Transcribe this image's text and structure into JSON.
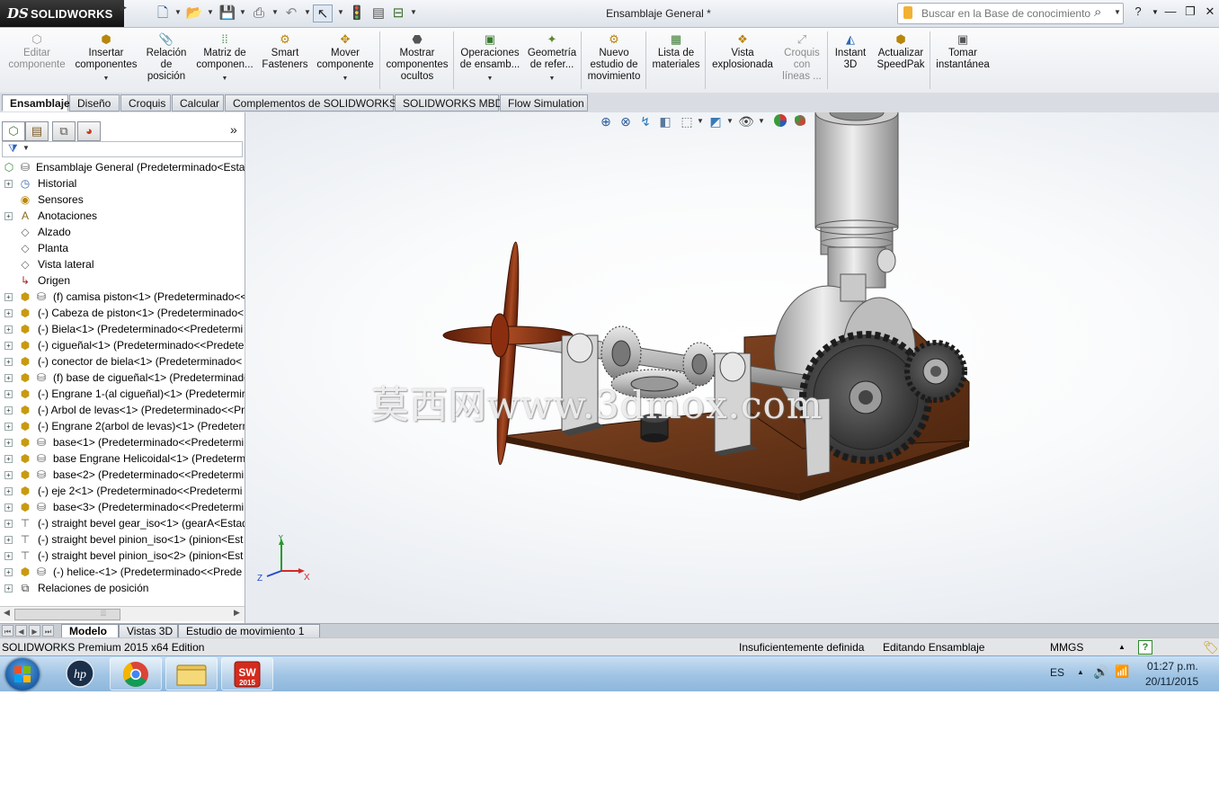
{
  "app": {
    "brand_icon": "DS",
    "brand": "SOLIDWORKS",
    "title": "Ensamblaje  General *",
    "search_placeholder": "Buscar en la Base de conocimiento"
  },
  "quick_access": [
    "new-icon",
    "open-icon",
    "save-icon",
    "print-icon",
    "undo-icon",
    "select-icon",
    "rebuild-icon",
    "file-properties-icon",
    "options-icon"
  ],
  "window_buttons": {
    "help": "?",
    "minimize": "—",
    "restore": "❐",
    "close": "✕"
  },
  "commands": [
    {
      "line1": "Editar",
      "line2": "componente",
      "line3": "",
      "enabled": false
    },
    {
      "line1": "Insertar",
      "line2": "componentes",
      "line3": "",
      "enabled": true
    },
    {
      "line1": "Relación",
      "line2": "de",
      "line3": "posición",
      "enabled": true
    },
    {
      "line1": "Matriz de",
      "line2": "componen...",
      "line3": "",
      "enabled": true
    },
    {
      "line1": "Smart",
      "line2": "Fasteners",
      "line3": "",
      "enabled": true
    },
    {
      "line1": "Mover",
      "line2": "componente",
      "line3": "",
      "enabled": true
    },
    {
      "line1": "Mostrar",
      "line2": "componentes",
      "line3": "ocultos",
      "enabled": true
    },
    {
      "line1": "Operaciones",
      "line2": "de ensamb...",
      "line3": "",
      "enabled": true
    },
    {
      "line1": "Geometría",
      "line2": "de refer...",
      "line3": "",
      "enabled": true
    },
    {
      "line1": "Nuevo",
      "line2": "estudio de",
      "line3": "movimiento",
      "enabled": true
    },
    {
      "line1": "Lista de",
      "line2": "materiales",
      "line3": "",
      "enabled": true
    },
    {
      "line1": "Vista",
      "line2": "explosionada",
      "line3": "",
      "enabled": true
    },
    {
      "line1": "Croquis",
      "line2": "con",
      "line3": "líneas ...",
      "enabled": false
    },
    {
      "line1": "Instant",
      "line2": "3D",
      "line3": "",
      "enabled": true
    },
    {
      "line1": "Actualizar",
      "line2": "SpeedPak",
      "line3": "",
      "enabled": true
    },
    {
      "line1": "Tomar",
      "line2": "instantánea",
      "line3": "",
      "enabled": true
    }
  ],
  "tabs": [
    "Ensamblaje",
    "Diseño",
    "Croquis",
    "Calcular",
    "Complementos de SOLIDWORKS",
    "SOLIDWORKS MBD",
    "Flow Simulation"
  ],
  "tree": [
    {
      "label": "Ensamblaje  General  (Predeterminado<Esta",
      "icon": "assembly-icon"
    },
    {
      "label": "Historial",
      "icon": "history-icon"
    },
    {
      "label": "Sensores",
      "icon": "sensor-icon"
    },
    {
      "label": "Anotaciones",
      "icon": "annotation-icon"
    },
    {
      "label": "Alzado",
      "icon": "plane-icon"
    },
    {
      "label": "Planta",
      "icon": "plane-icon"
    },
    {
      "label": "Vista lateral",
      "icon": "plane-icon"
    },
    {
      "label": "Origen",
      "icon": "origin-icon"
    },
    {
      "label": "(f) camisa piston<1> (Predeterminado<<",
      "icon": "part-icon"
    },
    {
      "label": "(-) Cabeza de piston<1> (Predeterminado<",
      "icon": "part-icon"
    },
    {
      "label": "(-) Biela<1> (Predeterminado<<Predetermi",
      "icon": "part-icon"
    },
    {
      "label": "(-) cigueñal<1> (Predeterminado<<Predete",
      "icon": "part-icon"
    },
    {
      "label": "(-) conector de biela<1> (Predeterminado<",
      "icon": "part-icon"
    },
    {
      "label": "(f) base de cigueñal<1> (Predeterminado",
      "icon": "part-icon"
    },
    {
      "label": "(-) Engrane 1-(al cigueñal)<1> (Predetermir",
      "icon": "part-icon"
    },
    {
      "label": "(-) Arbol de levas<1> (Predeterminado<<Pr",
      "icon": "part-icon"
    },
    {
      "label": "(-) Engrane 2(arbol de levas)<1> (Predeterm",
      "icon": "part-icon"
    },
    {
      "label": "base<1> (Predeterminado<<Predetermi",
      "icon": "part-icon"
    },
    {
      "label": "base Engrane Helicoidal<1> (Predeterm",
      "icon": "part-icon"
    },
    {
      "label": "base<2> (Predeterminado<<Predetermi",
      "icon": "part-icon"
    },
    {
      "label": "(-) eje 2<1> (Predeterminado<<Predetermi",
      "icon": "part-icon"
    },
    {
      "label": "base<3> (Predeterminado<<Predetermi",
      "icon": "part-icon"
    },
    {
      "label": "(-) straight bevel gear_iso<1> (gearA<Estad",
      "icon": "toolbox-part-icon"
    },
    {
      "label": "(-) straight bevel pinion_iso<1> (pinion<Est",
      "icon": "toolbox-part-icon"
    },
    {
      "label": "(-) straight bevel pinion_iso<2> (pinion<Est",
      "icon": "toolbox-part-icon"
    },
    {
      "label": "(-) helice-<1> (Predeterminado<<Prede",
      "icon": "part-icon"
    },
    {
      "label": "Relaciones de posición",
      "icon": "mates-icon"
    }
  ],
  "viewport": {
    "watermark": "莫西网www.3dmox.com",
    "triad": {
      "x": "X",
      "y": "Y",
      "z": "Z"
    }
  },
  "bottom_tabs": [
    "Modelo",
    "Vistas 3D",
    "Estudio de movimiento 1"
  ],
  "status": {
    "edition": "SOLIDWORKS Premium 2015 x64 Edition",
    "definition": "Insuficientemente definida",
    "mode": "Editando Ensamblaje",
    "units": "MMGS"
  },
  "taskbar": {
    "apps": [
      "hp-icon",
      "chrome-icon",
      "explorer-icon",
      "solidworks-icon"
    ],
    "sw_badge": "2015",
    "language": "ES",
    "time": "01:27 p.m.",
    "date": "20/11/2015"
  },
  "colors": {
    "wood": "#6b3518",
    "steel": "#9a9a9a",
    "propeller": "#8b2e10",
    "panel_bg": "#ffffff",
    "taskbar": "#a9c9e6"
  }
}
